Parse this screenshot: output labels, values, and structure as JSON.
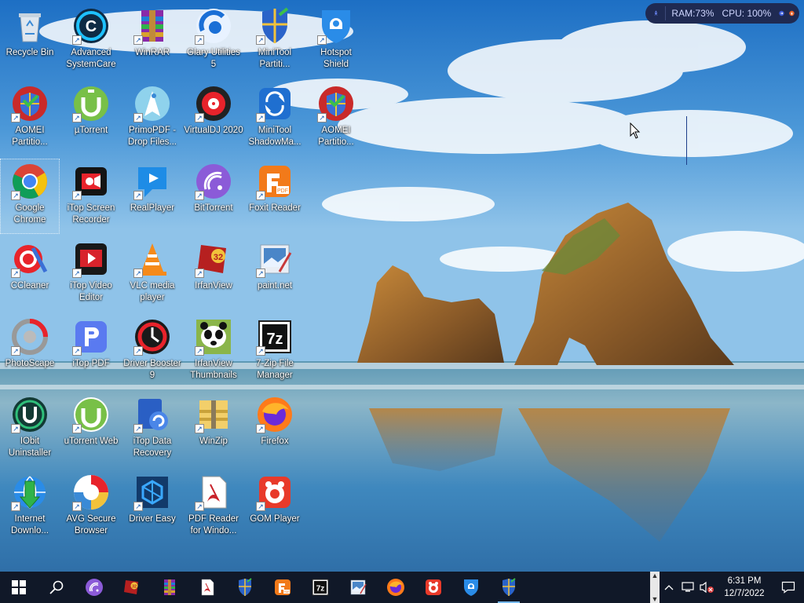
{
  "desktop": {
    "icons": [
      {
        "label": "Recycle Bin",
        "icon": "recycle-bin-icon",
        "shortcut": false
      },
      {
        "label": "Advanced\nSystemCare",
        "icon": "advanced-systemcare-icon",
        "shortcut": true
      },
      {
        "label": "WinRAR",
        "icon": "winrar-icon",
        "shortcut": true
      },
      {
        "label": "Glary Utilities\n5",
        "icon": "glary-utilities-icon",
        "shortcut": true
      },
      {
        "label": "MiniTool\nPartiti...",
        "icon": "minitool-partition-icon",
        "shortcut": true
      },
      {
        "label": "Hotspot\nShield",
        "icon": "hotspot-shield-icon",
        "shortcut": true
      },
      {
        "label": "AOMEI\nPartitio...",
        "icon": "aomei-partition-icon",
        "shortcut": true
      },
      {
        "label": "µTorrent",
        "icon": "utorrent-icon",
        "shortcut": true
      },
      {
        "label": "PrimoPDF -\nDrop Files...",
        "icon": "primopdf-icon",
        "shortcut": true
      },
      {
        "label": "VirtualDJ 2020",
        "icon": "virtualdj-icon",
        "shortcut": true
      },
      {
        "label": "MiniTool\nShadowMa...",
        "icon": "minitool-shadowmaker-icon",
        "shortcut": true
      },
      {
        "label": "AOMEI\nPartitio...",
        "icon": "aomei-partition-icon",
        "shortcut": true
      },
      {
        "label": "Google\nChrome",
        "icon": "chrome-icon",
        "shortcut": true
      },
      {
        "label": "iTop Screen\nRecorder",
        "icon": "itop-screen-recorder-icon",
        "shortcut": true
      },
      {
        "label": "RealPlayer",
        "icon": "realplayer-icon",
        "shortcut": true
      },
      {
        "label": "BitTorrent",
        "icon": "bittorrent-icon",
        "shortcut": true
      },
      {
        "label": "Foxit Reader",
        "icon": "foxit-reader-icon",
        "shortcut": true
      },
      {
        "label": "CCleaner",
        "icon": "ccleaner-icon",
        "shortcut": true
      },
      {
        "label": "iTop Video\nEditor",
        "icon": "itop-video-editor-icon",
        "shortcut": true
      },
      {
        "label": "VLC media\nplayer",
        "icon": "vlc-icon",
        "shortcut": true
      },
      {
        "label": "IrfanView",
        "icon": "irfanview-icon",
        "shortcut": true
      },
      {
        "label": "paint.net",
        "icon": "paintnet-icon",
        "shortcut": true
      },
      {
        "label": "PhotoScape",
        "icon": "photoscape-icon",
        "shortcut": true
      },
      {
        "label": "iTop PDF",
        "icon": "itop-pdf-icon",
        "shortcut": true
      },
      {
        "label": "Driver Booster\n9",
        "icon": "driver-booster-icon",
        "shortcut": true
      },
      {
        "label": "IrfanView\nThumbnails",
        "icon": "irfanview-thumbnails-icon",
        "shortcut": true
      },
      {
        "label": "7-Zip File\nManager",
        "icon": "7zip-icon",
        "shortcut": true
      },
      {
        "label": "IObit\nUninstaller",
        "icon": "iobit-uninstaller-icon",
        "shortcut": true
      },
      {
        "label": "uTorrent Web",
        "icon": "utorrent-web-icon",
        "shortcut": true
      },
      {
        "label": "iTop Data\nRecovery",
        "icon": "itop-data-recovery-icon",
        "shortcut": true
      },
      {
        "label": "WinZip",
        "icon": "winzip-icon",
        "shortcut": true
      },
      {
        "label": "Firefox",
        "icon": "firefox-icon",
        "shortcut": true
      },
      {
        "label": "Internet\nDownlo...",
        "icon": "internet-download-manager-icon",
        "shortcut": true
      },
      {
        "label": "AVG Secure\nBrowser",
        "icon": "avg-secure-browser-icon",
        "shortcut": true
      },
      {
        "label": "Driver Easy",
        "icon": "driver-easy-icon",
        "shortcut": true
      },
      {
        "label": "PDF Reader\nfor Windo...",
        "icon": "pdf-reader-icon",
        "shortcut": true
      },
      {
        "label": "GOM Player",
        "icon": "gom-player-icon",
        "shortcut": true
      }
    ],
    "focused_icon": "Google\nChrome"
  },
  "widget": {
    "ram_label": "RAM:73%",
    "cpu_label": "CPU: 100%",
    "icons": [
      "rocket-icon",
      "arrow-right-icon",
      "bell-icon"
    ]
  },
  "taskbar": {
    "items": [
      "start-icon",
      "search-icon",
      "bittorrent-icon",
      "irfanview-icon",
      "winrar-icon",
      "pdf-reader-icon",
      "minitool-partition-icon",
      "foxit-reader-icon",
      "7zip-icon",
      "paintnet-icon",
      "firefox-icon",
      "gom-player-icon",
      "hotspot-shield-icon",
      "minitool-partition-icon"
    ],
    "tray": {
      "time": "6:31 PM",
      "date": "12/7/2022",
      "icons": [
        "show-hidden-icons-chevron-icon",
        "network-icon",
        "volume-muted-icon",
        "notification-icon"
      ]
    }
  },
  "colors": {
    "taskbar_bg": "#101828",
    "widget_bg": "#1f2a52",
    "accent": "#76b9ed"
  }
}
